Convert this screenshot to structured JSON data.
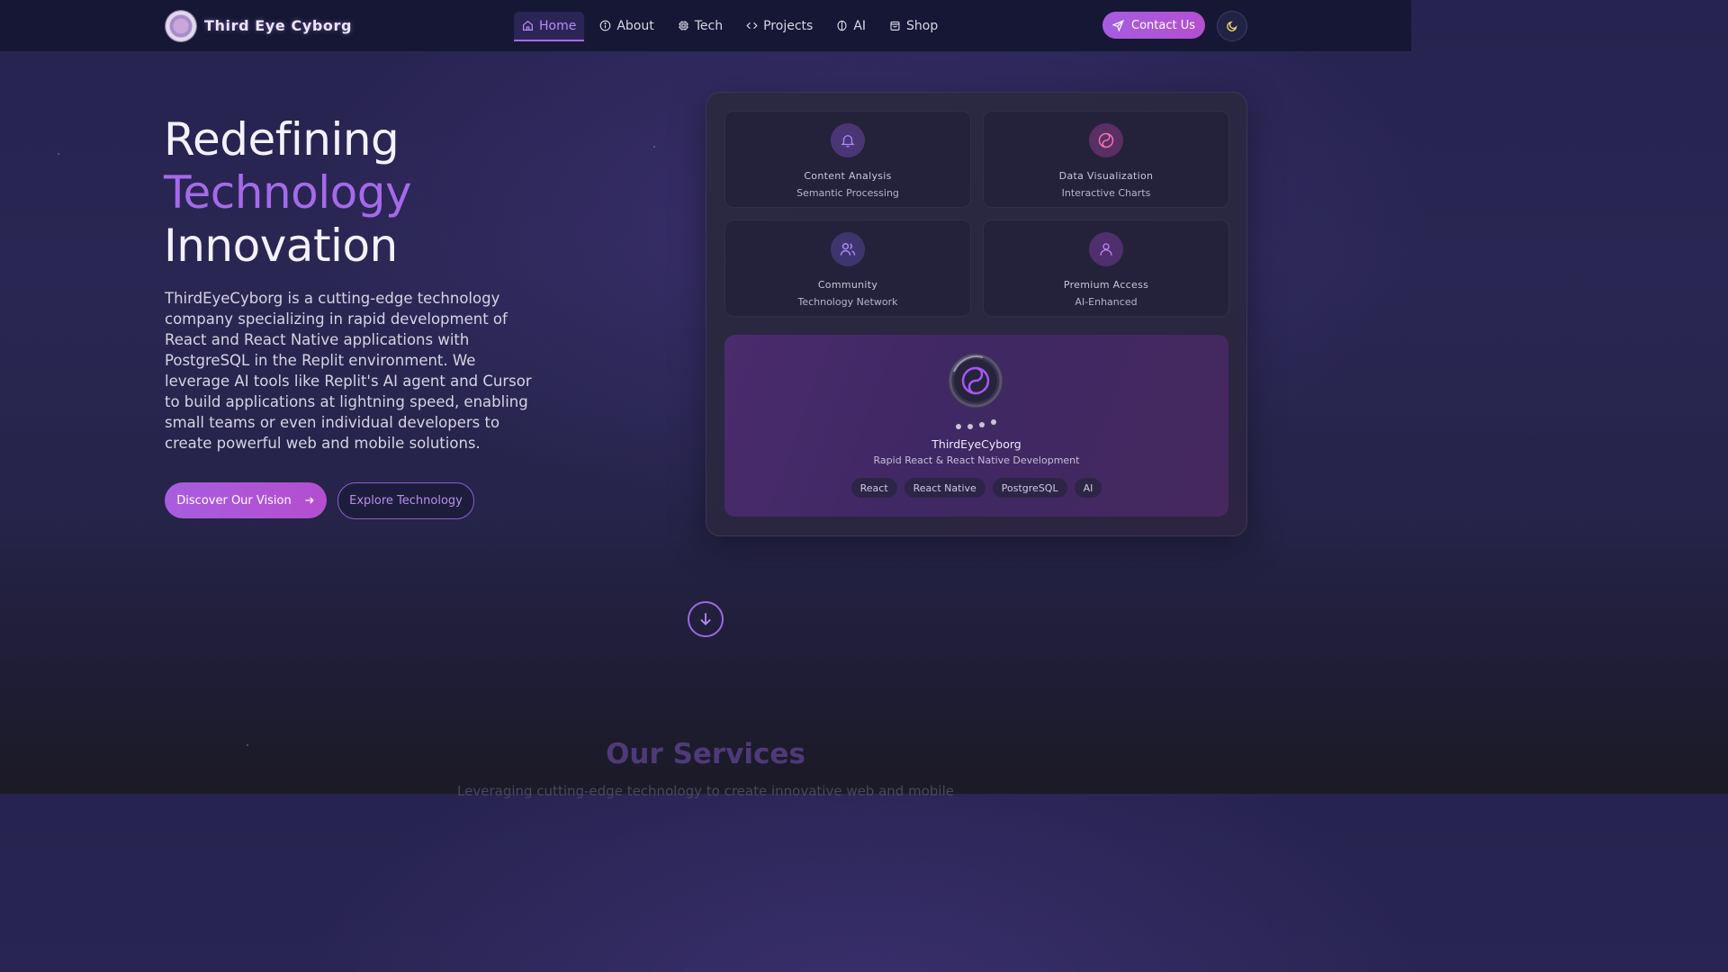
{
  "nav": {
    "brand": "Third Eye Cyborg",
    "items": [
      {
        "label": "Home",
        "icon": "home-icon",
        "active": true
      },
      {
        "label": "About",
        "icon": "info-icon",
        "active": false
      },
      {
        "label": "Tech",
        "icon": "chip-icon",
        "active": false
      },
      {
        "label": "Projects",
        "icon": "code-icon",
        "active": false
      },
      {
        "label": "AI",
        "icon": "brain-icon",
        "active": false
      },
      {
        "label": "Shop",
        "icon": "bag-icon",
        "active": false
      }
    ],
    "contact_label": "Contact Us",
    "theme_icon": "moon-icon"
  },
  "hero": {
    "line1": "Redefining",
    "line2": "Technology",
    "line3": "Innovation",
    "description": "ThirdEyeCyborg is a cutting-edge technology company specializing in rapid development of React and React Native applications with PostgreSQL in the Replit environment. We leverage AI tools like Replit's AI agent and Cursor to build applications at lightning speed, enabling small teams or even individual developers to create powerful web and mobile solutions.",
    "primary_button": "Discover Our Vision",
    "secondary_button": "Explore Technology"
  },
  "features": [
    {
      "title": "Content Analysis",
      "subtitle": "Semantic Processing",
      "icon": "bell-icon",
      "color": "#8b5cf6"
    },
    {
      "title": "Data Visualization",
      "subtitle": "Interactive Charts",
      "icon": "yin-yang-icon",
      "color": "#ec4899"
    },
    {
      "title": "Community",
      "subtitle": "Technology Network",
      "icon": "users-icon",
      "color": "#8b5cf6"
    },
    {
      "title": "Premium Access",
      "subtitle": "AI-Enhanced",
      "icon": "user-icon",
      "color": "#a855f7"
    }
  ],
  "showcase": {
    "title": "ThirdEyeCyborg",
    "subtitle": "Rapid React & React Native Development",
    "tags": [
      "React",
      "React Native",
      "PostgreSQL",
      "AI"
    ]
  },
  "scroll_icon": "arrow-down-icon",
  "services": {
    "title": "Our Services",
    "subtitle": "Leveraging cutting-edge technology to create innovative web and mobile"
  },
  "colors": {
    "accent": "#a46ae9",
    "nav_bg": "#161734",
    "button": "#a75ddf"
  }
}
